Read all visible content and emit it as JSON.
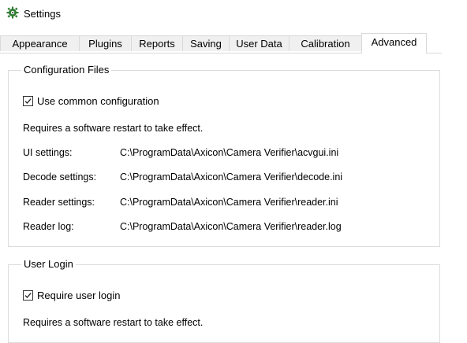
{
  "window": {
    "title": "Settings",
    "icon": "gear-icon"
  },
  "tabs": [
    {
      "label": "Appearance",
      "active": false
    },
    {
      "label": "Plugins",
      "active": false
    },
    {
      "label": "Reports",
      "active": false
    },
    {
      "label": "Saving",
      "active": false
    },
    {
      "label": "User Data",
      "active": false
    },
    {
      "label": "Calibration",
      "active": false
    },
    {
      "label": "Advanced",
      "active": true
    }
  ],
  "config_files": {
    "legend": "Configuration Files",
    "use_common": {
      "label": "Use common configuration",
      "checked": true
    },
    "restart_note": "Requires a software restart to take effect.",
    "paths": [
      {
        "label": "UI settings:",
        "value": "C:\\ProgramData\\Axicon\\Camera Verifier\\acvgui.ini"
      },
      {
        "label": "Decode settings:",
        "value": "C:\\ProgramData\\Axicon\\Camera Verifier\\decode.ini"
      },
      {
        "label": "Reader settings:",
        "value": "C:\\ProgramData\\Axicon\\Camera Verifier\\reader.ini"
      },
      {
        "label": "Reader log:",
        "value": "C:\\ProgramData\\Axicon\\Camera Verifier\\reader.log"
      }
    ]
  },
  "user_login": {
    "legend": "User Login",
    "require_login": {
      "label": "Require user login",
      "checked": true
    },
    "restart_note": "Requires a software restart to take effect."
  },
  "colors": {
    "border": "#d9d9d9",
    "tab_inactive_bg": "#f0f0f0",
    "background": "#ffffff"
  }
}
